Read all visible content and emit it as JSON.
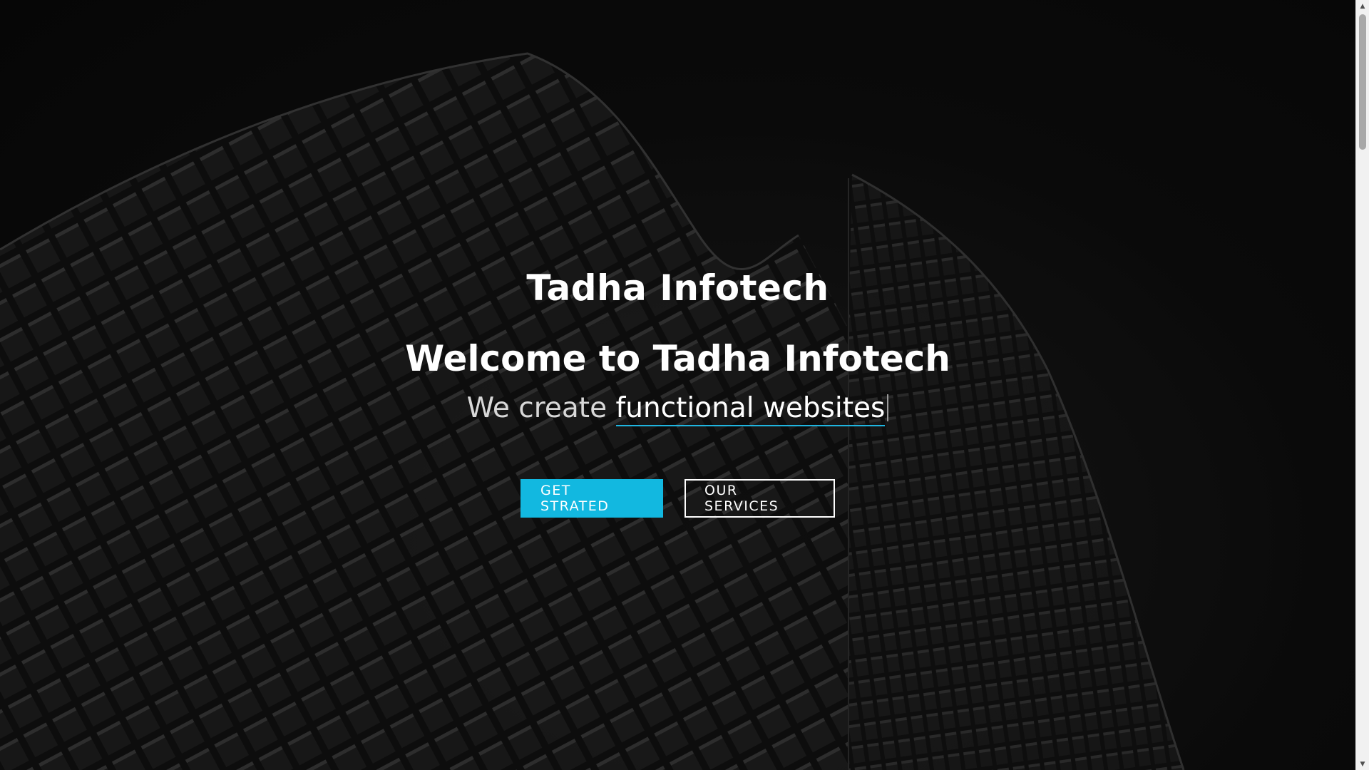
{
  "hero": {
    "brand_title": "Tadha Infotech",
    "welcome_heading": "Welcome to Tadha Infotech",
    "tagline_prefix": "We create ",
    "tagline_typed": "functional websites",
    "background_image": "building-facade-image"
  },
  "buttons": {
    "get_started_label": "GET STRATED",
    "our_services_label": "OUR SERVICES"
  },
  "colors": {
    "accent": "#12b8e0",
    "background": "#0a0a0a",
    "text": "#ffffff"
  },
  "scrollbar": {
    "up_icon": "scroll-up-arrow-icon",
    "down_icon": "scroll-down-arrow-icon"
  }
}
